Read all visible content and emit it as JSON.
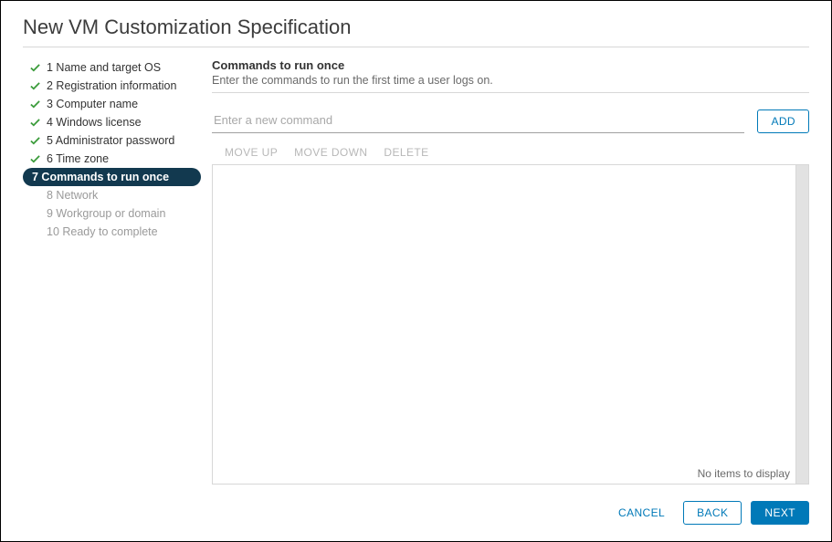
{
  "dialog": {
    "title": "New VM Customization Specification"
  },
  "sidebar": {
    "steps": [
      {
        "label": "1 Name and target OS",
        "state": "completed"
      },
      {
        "label": "2 Registration information",
        "state": "completed"
      },
      {
        "label": "3 Computer name",
        "state": "completed"
      },
      {
        "label": "4 Windows license",
        "state": "completed"
      },
      {
        "label": "5 Administrator password",
        "state": "completed"
      },
      {
        "label": "6 Time zone",
        "state": "completed"
      },
      {
        "label": "7 Commands to run once",
        "state": "active"
      },
      {
        "label": "8 Network",
        "state": "pending"
      },
      {
        "label": "9 Workgroup or domain",
        "state": "pending"
      },
      {
        "label": "10 Ready to complete",
        "state": "pending"
      }
    ]
  },
  "main": {
    "section_title": "Commands to run once",
    "section_desc": "Enter the commands to run the first time a user logs on.",
    "command_input_placeholder": "Enter a new command",
    "command_input_value": "",
    "add_button": "ADD",
    "actions": {
      "move_up": "MOVE UP",
      "move_down": "MOVE DOWN",
      "delete": "DELETE"
    },
    "no_items_text": "No items to display"
  },
  "footer": {
    "cancel": "CANCEL",
    "back": "BACK",
    "next": "NEXT"
  }
}
